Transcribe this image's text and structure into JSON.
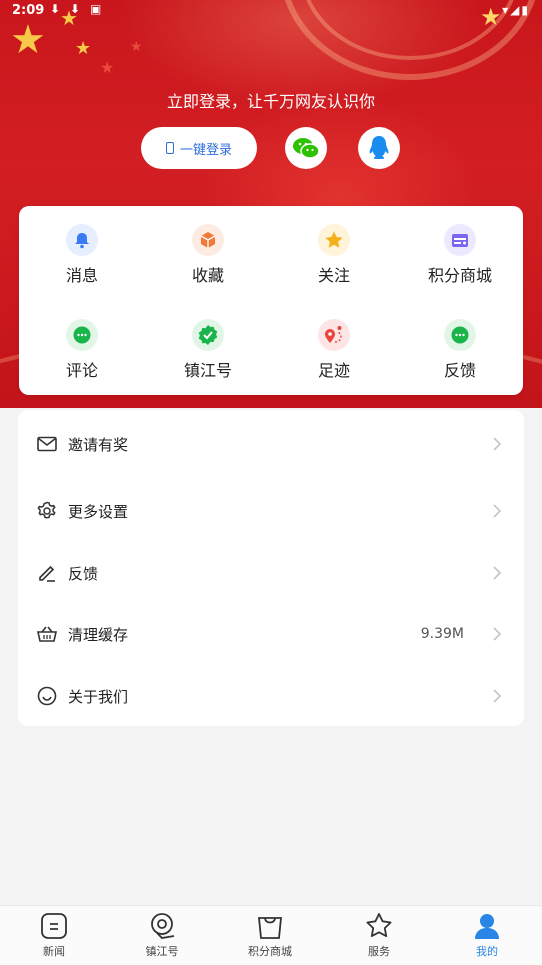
{
  "status_bar": {
    "time": "2:09"
  },
  "header": {
    "login_hint": "立即登录，让千万网友认识你",
    "one_click_login": "一键登录",
    "social": [
      "wechat-icon",
      "qq-icon"
    ]
  },
  "quick_grid": [
    {
      "label": "消息",
      "icon": "bell-icon",
      "bg": "#e6efff",
      "color": "#3a7af2"
    },
    {
      "label": "收藏",
      "icon": "box-icon",
      "bg": "#fdebe2",
      "color": "#f07a3a"
    },
    {
      "label": "关注",
      "icon": "star-icon",
      "bg": "#fff3da",
      "color": "#f4b11a"
    },
    {
      "label": "积分商城",
      "icon": "store-icon",
      "bg": "#ece8ff",
      "color": "#7a64f0"
    },
    {
      "label": "评论",
      "icon": "comment-icon",
      "bg": "#e2f6e8",
      "color": "#19b44a"
    },
    {
      "label": "镇江号",
      "icon": "verified-icon",
      "bg": "#e2f6e8",
      "color": "#19b44a"
    },
    {
      "label": "足迹",
      "icon": "route-icon",
      "bg": "#fde5e5",
      "color": "#e8453c"
    },
    {
      "label": "反馈",
      "icon": "feedback-icon",
      "bg": "#e2f6e8",
      "color": "#19b44a"
    }
  ],
  "menu": [
    {
      "label": "邀请有奖",
      "icon": "mail-icon",
      "value": ""
    },
    {
      "label": "更多设置",
      "icon": "gear-icon",
      "value": ""
    },
    {
      "label": "反馈",
      "icon": "edit-icon",
      "value": ""
    },
    {
      "label": "清理缓存",
      "icon": "basket-icon",
      "value": "9.39M"
    },
    {
      "label": "关于我们",
      "icon": "smile-icon",
      "value": ""
    }
  ],
  "tabs": [
    {
      "label": "新闻",
      "icon": "news-icon"
    },
    {
      "label": "镇江号",
      "icon": "pin-icon"
    },
    {
      "label": "积分商城",
      "icon": "bag-icon"
    },
    {
      "label": "服务",
      "icon": "star-outline-icon"
    },
    {
      "label": "我的",
      "icon": "person-icon",
      "active": true
    }
  ],
  "colors": {
    "brand_red": "#c8161c",
    "accent_blue": "#2a86e6"
  }
}
